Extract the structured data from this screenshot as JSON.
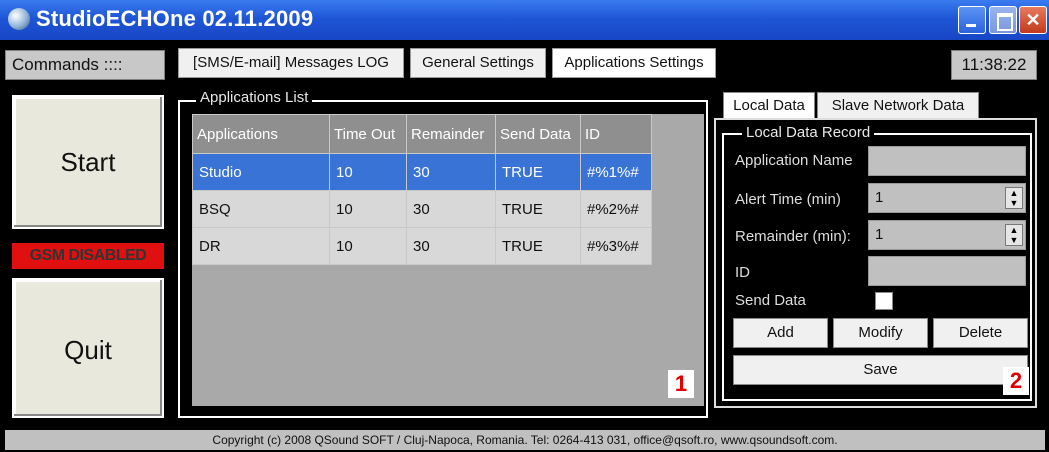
{
  "window": {
    "title": "StudioECHOne 02.11.2009",
    "buttons": {
      "minimize": "",
      "maximize": "",
      "close": "✕"
    }
  },
  "toolbar": {
    "commands_label": "Commands ::::",
    "tabs": [
      "[SMS/E-mail] Messages LOG",
      "General Settings",
      "Applications Settings"
    ],
    "clock": "11:38:22"
  },
  "left": {
    "start": "Start",
    "gsm_status": "GSM DISABLED",
    "quit": "Quit"
  },
  "apps_list": {
    "title": "Applications List",
    "columns": [
      "Applications",
      "Time Out",
      "Remainder",
      "Send Data",
      "ID"
    ],
    "rows": [
      [
        "Studio",
        "10",
        "30",
        "TRUE",
        "#%1%#"
      ],
      [
        "BSQ",
        "10",
        "30",
        "TRUE",
        "#%2%#"
      ],
      [
        "DR",
        "10",
        "30",
        "TRUE",
        "#%3%#"
      ]
    ],
    "selected_row": 0,
    "marker": "1"
  },
  "right": {
    "tabs": [
      "Local Data",
      "Slave Network Data"
    ],
    "group_title": "Local Data Record",
    "fields": {
      "app_name_label": "Application Name",
      "app_name_value": "",
      "alert_label": "Alert Time (min)",
      "alert_value": "1",
      "remainder_label": "Remainder (min):",
      "remainder_value": "1",
      "id_label": "ID",
      "id_value": "",
      "send_label": "Send Data"
    },
    "buttons": {
      "add": "Add",
      "modify": "Modify",
      "delete": "Delete",
      "save": "Save"
    },
    "marker": "2"
  },
  "footer": "Copyright (c) 2008 QSound SOFT / Cluj-Napoca, Romania. Tel: 0264-413 031, office@qsoft.ro, www.qsoundsoft.com.",
  "colors": {
    "selected": "#3a73d6",
    "gsm": "#e01010",
    "titlebar": "#1f56d6"
  }
}
